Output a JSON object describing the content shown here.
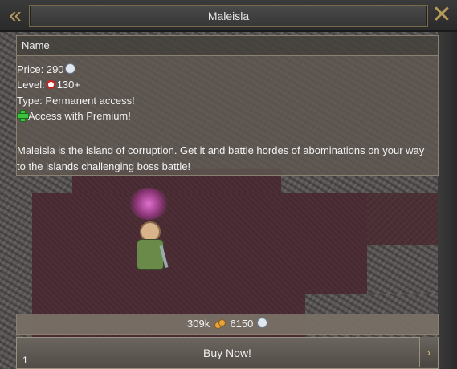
{
  "window": {
    "title": "Maleisla"
  },
  "header": {
    "name_label": "Name"
  },
  "item": {
    "price_label": "Price: 290",
    "level_prefix": "Level:",
    "level_value": "130+",
    "type_line": "Type: Permanent access!",
    "premium_line": "Access with Premium!",
    "description": "Maleisla is the island of corruption. Get it and battle hordes of abominations on your way to the islands challenging boss battle!"
  },
  "balance": {
    "gold": "309k",
    "coins": "6150"
  },
  "buy": {
    "label": "Buy Now!"
  },
  "page": {
    "number": "1"
  },
  "icons": {
    "title_left": "double-chevron-left-icon",
    "title_right": "close-x-icon",
    "coin": "silver-coin-icon",
    "level": "level-target-icon",
    "premium": "green-plus-icon",
    "gold": "gold-coins-icon",
    "arrow": "chevron-right-icon"
  },
  "colors": {
    "premium_green": "#3cc23c",
    "level_red": "#d02020",
    "gold": "#e8a33a",
    "frame_gold": "#b89a5a"
  }
}
